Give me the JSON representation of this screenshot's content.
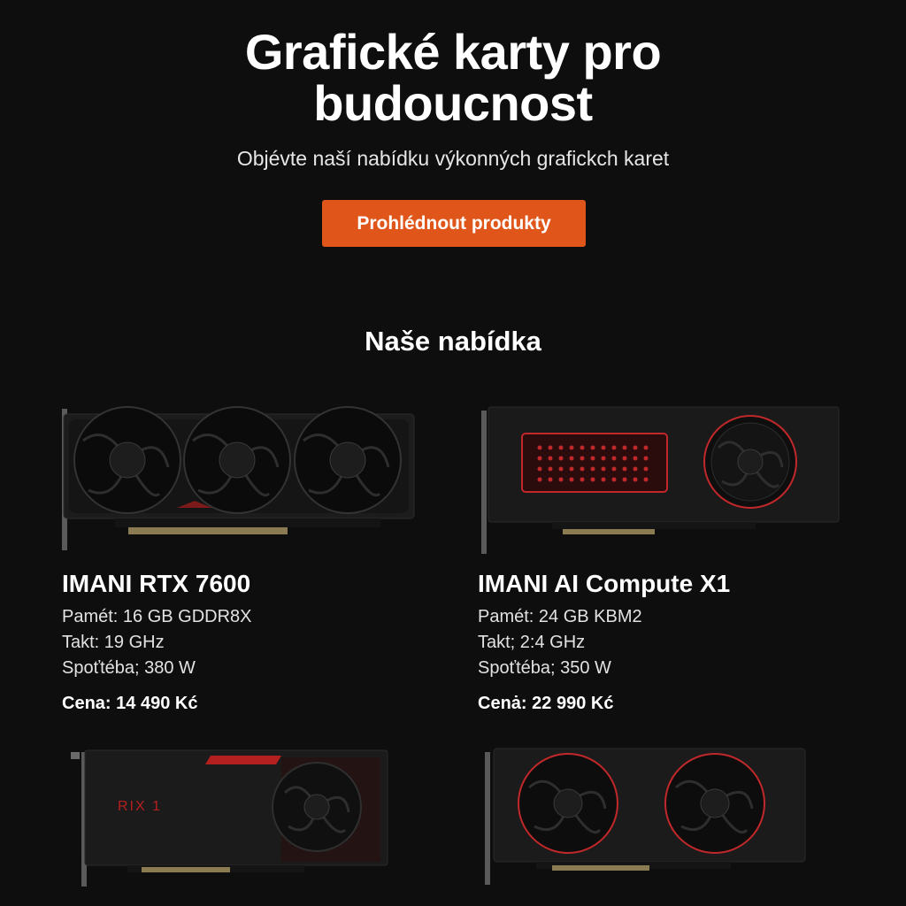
{
  "hero": {
    "title_line1": "Grafické karty pro",
    "title_line2": "budoucnost",
    "subtitle": "Objévte naší nabídku výkonných grafickch karet",
    "cta_label": "Prohlédnout produkty"
  },
  "section": {
    "title": "Naše nabídka"
  },
  "colors": {
    "accent": "#e0561a",
    "background": "#0e0e0e",
    "card_red": "#c0282a"
  },
  "products": [
    {
      "name": "IMANI RTX 7600",
      "memory": "Pamét: 16 GB GDDR8X",
      "clock": "Takt: 19 GHz",
      "power": "Spoťtéba; 380 W",
      "price_label": "Cena:",
      "price": "14 490 Kć",
      "image_icon": "gpu-triple-fan-icon"
    },
    {
      "name": "IMANI AI Compute X1",
      "memory": "Pamét: 24 GB KBM2",
      "clock": "Takt; 2:4 GHz",
      "power": "Spoťtéba; 350 W",
      "price_label": "Cenȧ:",
      "price": "22 990 Kć",
      "image_icon": "gpu-blower-compute-icon"
    },
    {
      "badge_text": "RIX 1",
      "image_icon": "gpu-blower-icon"
    },
    {
      "image_icon": "gpu-dual-fan-icon"
    }
  ]
}
